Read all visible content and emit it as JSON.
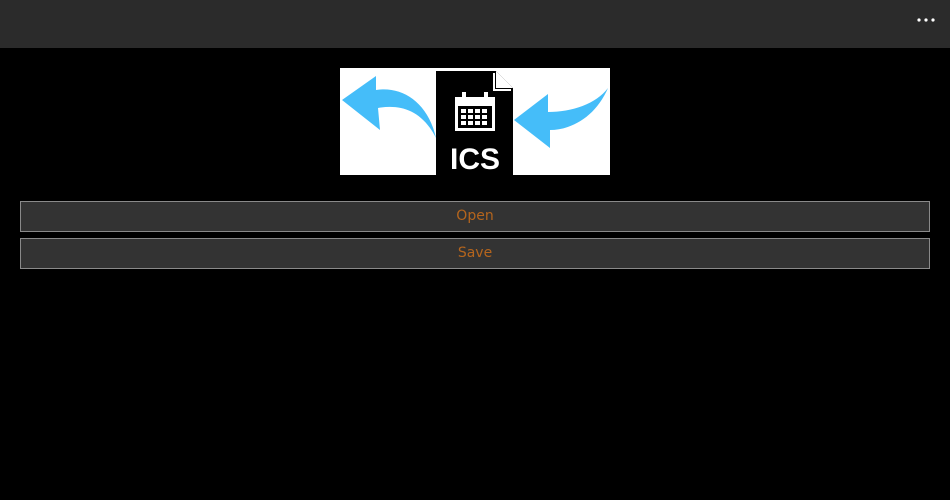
{
  "titlebar": {
    "menu_icon": "more-horizontal-icon"
  },
  "banner": {
    "file_label": "ICS",
    "icons": [
      "arrow-left-icon",
      "ics-file-icon",
      "calendar-icon",
      "arrow-right-icon"
    ]
  },
  "actions": {
    "open_label": "Open",
    "save_label": "Save"
  },
  "colors": {
    "background": "#000000",
    "titlebar": "#2b2b2b",
    "button_bg": "#333333",
    "button_text": "#b5651d",
    "arrow": "#45bdf9"
  }
}
